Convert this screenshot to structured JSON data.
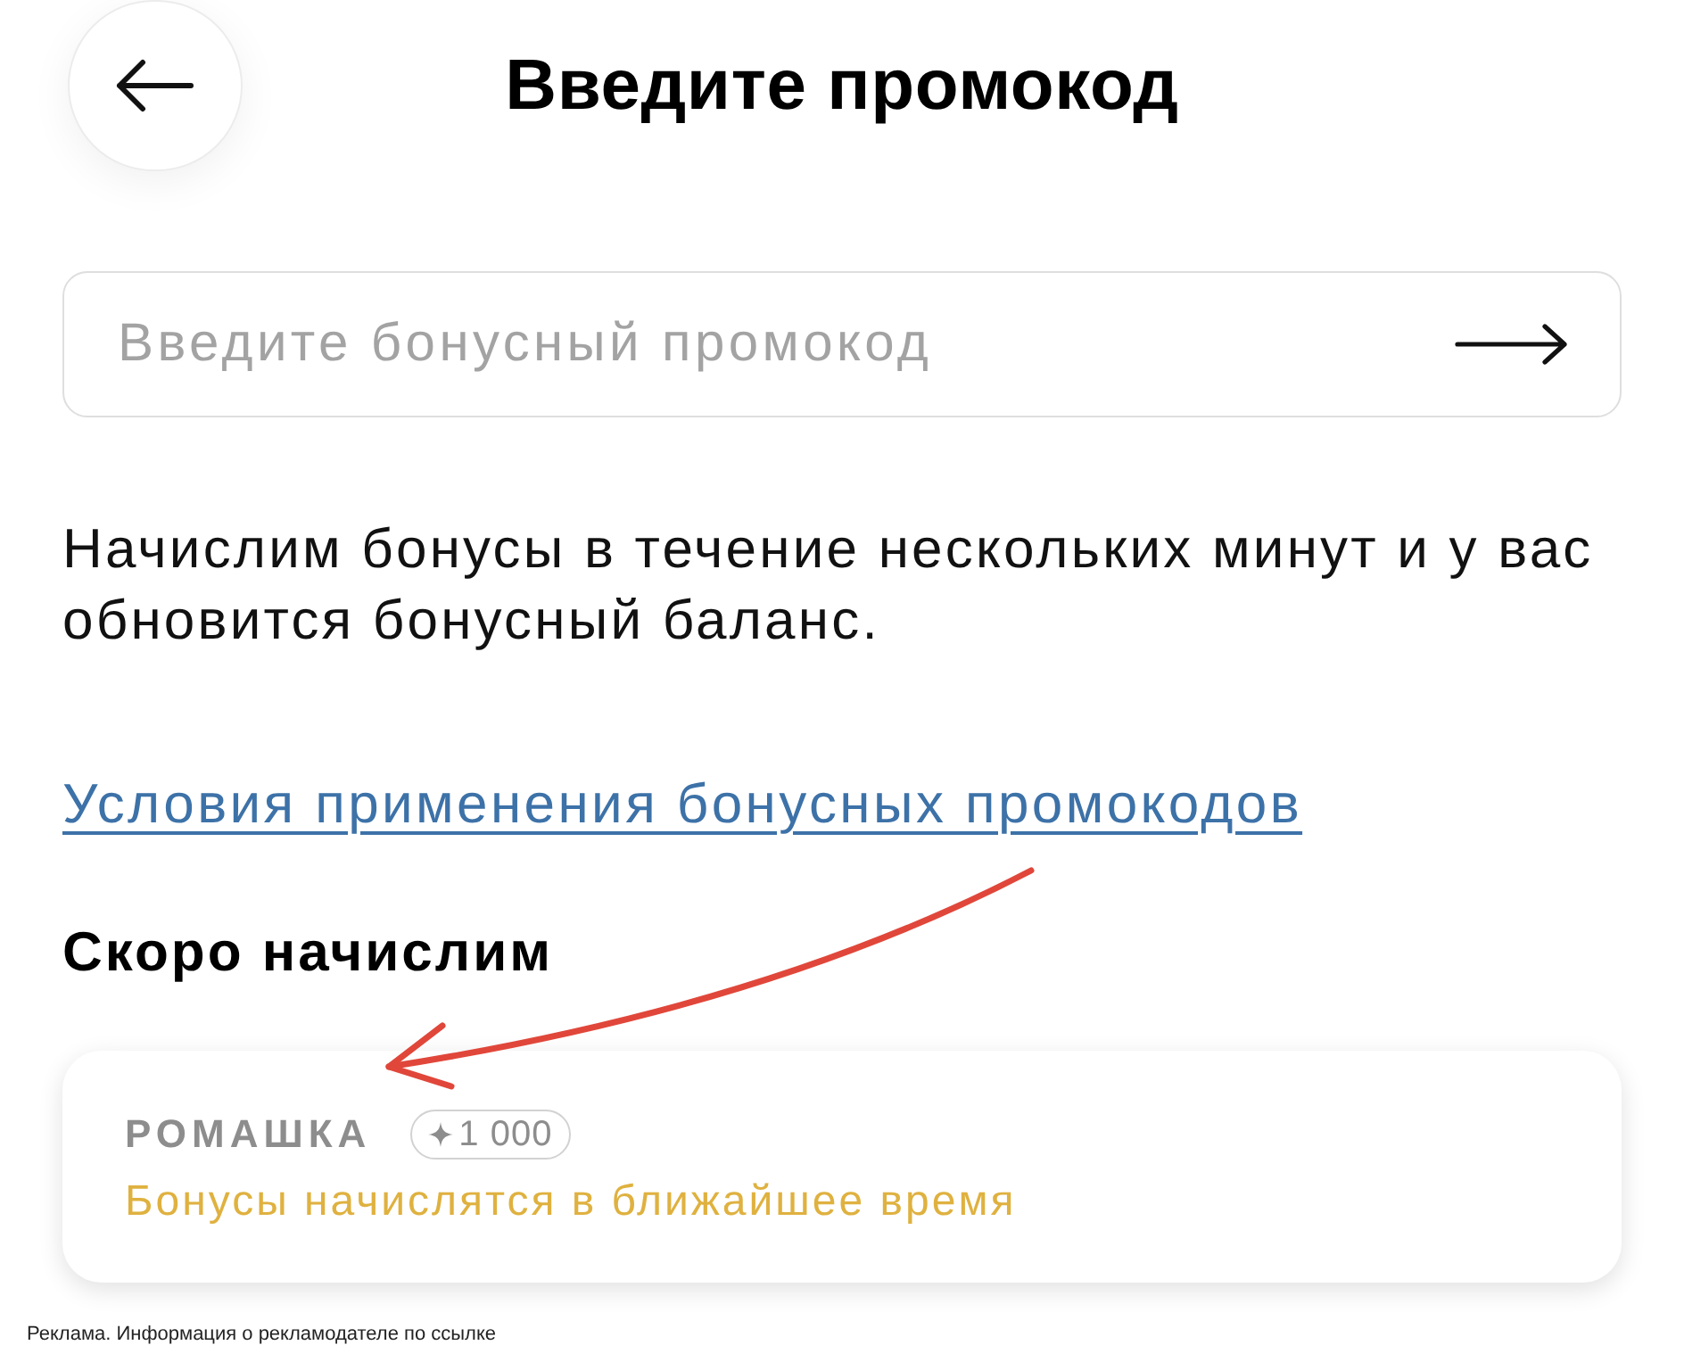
{
  "header": {
    "title": "Введите промокод"
  },
  "promo_field": {
    "placeholder": "Введите бонусный промокод"
  },
  "info_text": "Начислим бонусы в течение нескольких минут и у вас обновится бонусный баланс.",
  "terms_link": "Условия применения бонусных промокодов",
  "pending_section": {
    "title": "Скоро начислим",
    "items": [
      {
        "name": "РОМАШКА",
        "amount": "1 000",
        "status": "Бонусы начислятся в ближайшее время"
      }
    ]
  },
  "ad_notice": "Реклама. Информация о рекламодателе по ссылке"
}
